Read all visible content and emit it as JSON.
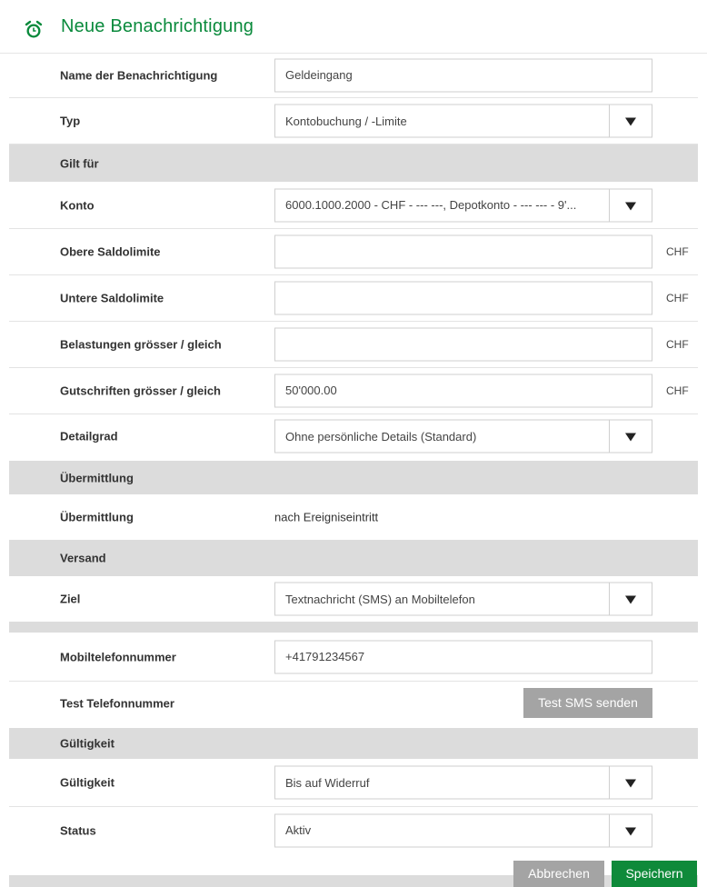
{
  "header": {
    "title": "Neue Benachrichtigung",
    "icon": "alarm-clock-icon"
  },
  "fields": {
    "name": {
      "label": "Name der Benachrichtigung",
      "value": "Geldeingang"
    },
    "typ": {
      "label": "Typ",
      "value": "Kontobuchung / -Limite"
    },
    "konto": {
      "label": "Konto",
      "value": "6000.1000.2000 - CHF - --- ---, Depotkonto - --- --- - 9'..."
    },
    "obere": {
      "label": "Obere Saldolimite",
      "value": "",
      "unit": "CHF"
    },
    "untere": {
      "label": "Untere Saldolimite",
      "value": "",
      "unit": "CHF"
    },
    "belastungen": {
      "label": "Belastungen grösser / gleich",
      "value": "",
      "unit": "CHF"
    },
    "gutschriften": {
      "label": "Gutschriften grösser / gleich",
      "value": "50'000.00",
      "unit": "CHF"
    },
    "detailgrad": {
      "label": "Detailgrad",
      "value": "Ohne persönliche Details (Standard)"
    },
    "uebermittlung": {
      "label": "Übermittlung",
      "value": "nach Ereigniseintritt"
    },
    "ziel": {
      "label": "Ziel",
      "value": "Textnachricht (SMS) an Mobiltelefon"
    },
    "mobil": {
      "label": "Mobiltelefonnummer",
      "value": "+41791234567"
    },
    "test_tel": {
      "label": "Test Telefonnummer",
      "button": "Test SMS senden"
    },
    "gueltigkeit": {
      "label": "Gültigkeit",
      "value": "Bis auf Widerruf"
    },
    "status": {
      "label": "Status",
      "value": "Aktiv"
    }
  },
  "sections": {
    "gilt_fuer": "Gilt für",
    "uebermittlung": "Übermittlung",
    "versand": "Versand",
    "gueltigkeit": "Gültigkeit"
  },
  "actions": {
    "cancel": "Abbrechen",
    "save": "Speichern"
  },
  "colors": {
    "accent": "#0a8a3c",
    "section_bg": "#dcdcdc",
    "button_grey": "#a4a4a4",
    "button_green": "#0f8a3a"
  }
}
